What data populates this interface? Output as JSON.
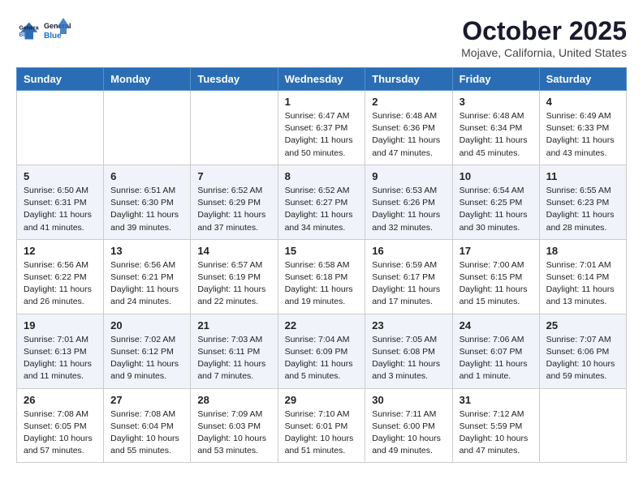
{
  "header": {
    "logo_line1": "General",
    "logo_line2": "Blue",
    "month": "October 2025",
    "location": "Mojave, California, United States"
  },
  "weekdays": [
    "Sunday",
    "Monday",
    "Tuesday",
    "Wednesday",
    "Thursday",
    "Friday",
    "Saturday"
  ],
  "weeks": [
    [
      {
        "day": "",
        "info": ""
      },
      {
        "day": "",
        "info": ""
      },
      {
        "day": "",
        "info": ""
      },
      {
        "day": "1",
        "info": "Sunrise: 6:47 AM\nSunset: 6:37 PM\nDaylight: 11 hours\nand 50 minutes."
      },
      {
        "day": "2",
        "info": "Sunrise: 6:48 AM\nSunset: 6:36 PM\nDaylight: 11 hours\nand 47 minutes."
      },
      {
        "day": "3",
        "info": "Sunrise: 6:48 AM\nSunset: 6:34 PM\nDaylight: 11 hours\nand 45 minutes."
      },
      {
        "day": "4",
        "info": "Sunrise: 6:49 AM\nSunset: 6:33 PM\nDaylight: 11 hours\nand 43 minutes."
      }
    ],
    [
      {
        "day": "5",
        "info": "Sunrise: 6:50 AM\nSunset: 6:31 PM\nDaylight: 11 hours\nand 41 minutes."
      },
      {
        "day": "6",
        "info": "Sunrise: 6:51 AM\nSunset: 6:30 PM\nDaylight: 11 hours\nand 39 minutes."
      },
      {
        "day": "7",
        "info": "Sunrise: 6:52 AM\nSunset: 6:29 PM\nDaylight: 11 hours\nand 37 minutes."
      },
      {
        "day": "8",
        "info": "Sunrise: 6:52 AM\nSunset: 6:27 PM\nDaylight: 11 hours\nand 34 minutes."
      },
      {
        "day": "9",
        "info": "Sunrise: 6:53 AM\nSunset: 6:26 PM\nDaylight: 11 hours\nand 32 minutes."
      },
      {
        "day": "10",
        "info": "Sunrise: 6:54 AM\nSunset: 6:25 PM\nDaylight: 11 hours\nand 30 minutes."
      },
      {
        "day": "11",
        "info": "Sunrise: 6:55 AM\nSunset: 6:23 PM\nDaylight: 11 hours\nand 28 minutes."
      }
    ],
    [
      {
        "day": "12",
        "info": "Sunrise: 6:56 AM\nSunset: 6:22 PM\nDaylight: 11 hours\nand 26 minutes."
      },
      {
        "day": "13",
        "info": "Sunrise: 6:56 AM\nSunset: 6:21 PM\nDaylight: 11 hours\nand 24 minutes."
      },
      {
        "day": "14",
        "info": "Sunrise: 6:57 AM\nSunset: 6:19 PM\nDaylight: 11 hours\nand 22 minutes."
      },
      {
        "day": "15",
        "info": "Sunrise: 6:58 AM\nSunset: 6:18 PM\nDaylight: 11 hours\nand 19 minutes."
      },
      {
        "day": "16",
        "info": "Sunrise: 6:59 AM\nSunset: 6:17 PM\nDaylight: 11 hours\nand 17 minutes."
      },
      {
        "day": "17",
        "info": "Sunrise: 7:00 AM\nSunset: 6:15 PM\nDaylight: 11 hours\nand 15 minutes."
      },
      {
        "day": "18",
        "info": "Sunrise: 7:01 AM\nSunset: 6:14 PM\nDaylight: 11 hours\nand 13 minutes."
      }
    ],
    [
      {
        "day": "19",
        "info": "Sunrise: 7:01 AM\nSunset: 6:13 PM\nDaylight: 11 hours\nand 11 minutes."
      },
      {
        "day": "20",
        "info": "Sunrise: 7:02 AM\nSunset: 6:12 PM\nDaylight: 11 hours\nand 9 minutes."
      },
      {
        "day": "21",
        "info": "Sunrise: 7:03 AM\nSunset: 6:11 PM\nDaylight: 11 hours\nand 7 minutes."
      },
      {
        "day": "22",
        "info": "Sunrise: 7:04 AM\nSunset: 6:09 PM\nDaylight: 11 hours\nand 5 minutes."
      },
      {
        "day": "23",
        "info": "Sunrise: 7:05 AM\nSunset: 6:08 PM\nDaylight: 11 hours\nand 3 minutes."
      },
      {
        "day": "24",
        "info": "Sunrise: 7:06 AM\nSunset: 6:07 PM\nDaylight: 11 hours\nand 1 minute."
      },
      {
        "day": "25",
        "info": "Sunrise: 7:07 AM\nSunset: 6:06 PM\nDaylight: 10 hours\nand 59 minutes."
      }
    ],
    [
      {
        "day": "26",
        "info": "Sunrise: 7:08 AM\nSunset: 6:05 PM\nDaylight: 10 hours\nand 57 minutes."
      },
      {
        "day": "27",
        "info": "Sunrise: 7:08 AM\nSunset: 6:04 PM\nDaylight: 10 hours\nand 55 minutes."
      },
      {
        "day": "28",
        "info": "Sunrise: 7:09 AM\nSunset: 6:03 PM\nDaylight: 10 hours\nand 53 minutes."
      },
      {
        "day": "29",
        "info": "Sunrise: 7:10 AM\nSunset: 6:01 PM\nDaylight: 10 hours\nand 51 minutes."
      },
      {
        "day": "30",
        "info": "Sunrise: 7:11 AM\nSunset: 6:00 PM\nDaylight: 10 hours\nand 49 minutes."
      },
      {
        "day": "31",
        "info": "Sunrise: 7:12 AM\nSunset: 5:59 PM\nDaylight: 10 hours\nand 47 minutes."
      },
      {
        "day": "",
        "info": ""
      }
    ]
  ]
}
